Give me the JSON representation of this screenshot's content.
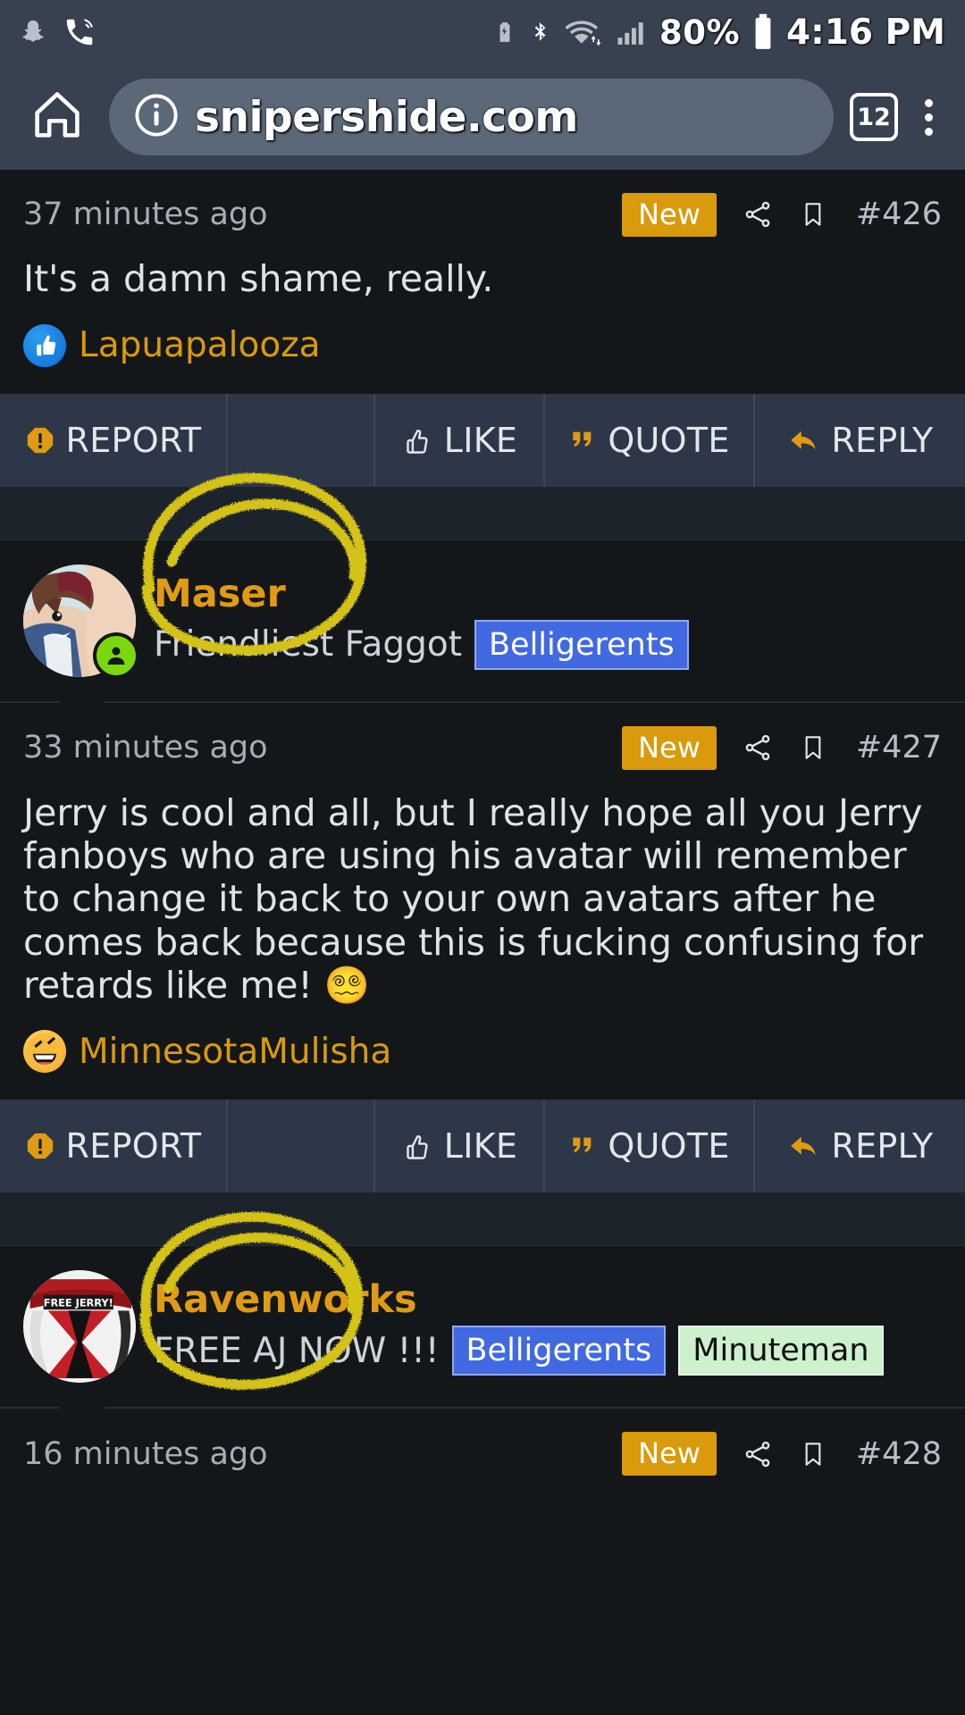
{
  "statusbar": {
    "icons_left": [
      "snapchat-icon",
      "call-signal-icon"
    ],
    "icons_right": [
      "battery-saver-icon",
      "bluetooth-icon",
      "wifi-icon",
      "cellular-signal-icon"
    ],
    "battery_percent": "80%",
    "time": "4:16 PM"
  },
  "browser": {
    "home_icon": "home-icon",
    "info_icon": "info-circle-icon",
    "url": "nipershide.com",
    "url_prefix": "s",
    "tab_count": "12",
    "menu_icon": "overflow-menu-icon"
  },
  "actions": {
    "report": "REPORT",
    "like": "LIKE",
    "quote": "QUOTE",
    "reply": "REPLY"
  },
  "colors": {
    "accent_orange": "#d99a0b",
    "username_orange": "#e09b13",
    "badge_blue": "#4169e1",
    "badge_green": "#cdf0cd",
    "annotation_yellow": "#d4c319",
    "page_bg": "#14171a",
    "actionbar_bg": "#2d3748",
    "chrome_bg": "#37414f"
  },
  "posts": [
    {
      "timeago": "37 minutes ago",
      "new_label": "New",
      "share_icon": "share-icon",
      "bookmark_icon": "bookmark-icon",
      "number": "#426",
      "body": "It's a damn shame, really.",
      "signature": {
        "reaction": "thumbs-up-reaction-icon",
        "name": "Lapuapalooza"
      }
    },
    {
      "timeago": "33 minutes ago",
      "new_label": "New",
      "share_icon": "share-icon",
      "bookmark_icon": "bookmark-icon",
      "number": "#427",
      "body": "Jerry is cool and all, but I really hope all you Jerry fanboys who are using his avatar will remember to change it back to your own avatars after he comes back because this is fucking confusing for retards like me! 😵‍💫",
      "signature": {
        "reaction": "rofl-reaction-icon",
        "name": "MinnesotaMulisha"
      }
    },
    {
      "timeago": "16 minutes ago",
      "new_label": "New",
      "share_icon": "share-icon",
      "bookmark_icon": "bookmark-icon",
      "number": "#428"
    }
  ],
  "users": [
    {
      "name": "Maser",
      "title": "Friendliest Faggot",
      "badges": [
        {
          "label": "Belligerents",
          "style": "blue"
        }
      ],
      "avatar": "anime-boy-avatar",
      "online": true,
      "circled": true
    },
    {
      "name": "Ravenworks",
      "title": "FREE AJ NOW !!!",
      "badges": [
        {
          "label": "Belligerents",
          "style": "blue"
        },
        {
          "label": "Minuteman",
          "style": "green"
        }
      ],
      "avatar": "free-jerry-hat-avatar",
      "online": false,
      "circled": true
    }
  ],
  "annotations": [
    {
      "name": "yellow-circle-around-maser",
      "color": "#d4c319"
    },
    {
      "name": "yellow-circle-around-ravenworks",
      "color": "#d4c319"
    }
  ]
}
